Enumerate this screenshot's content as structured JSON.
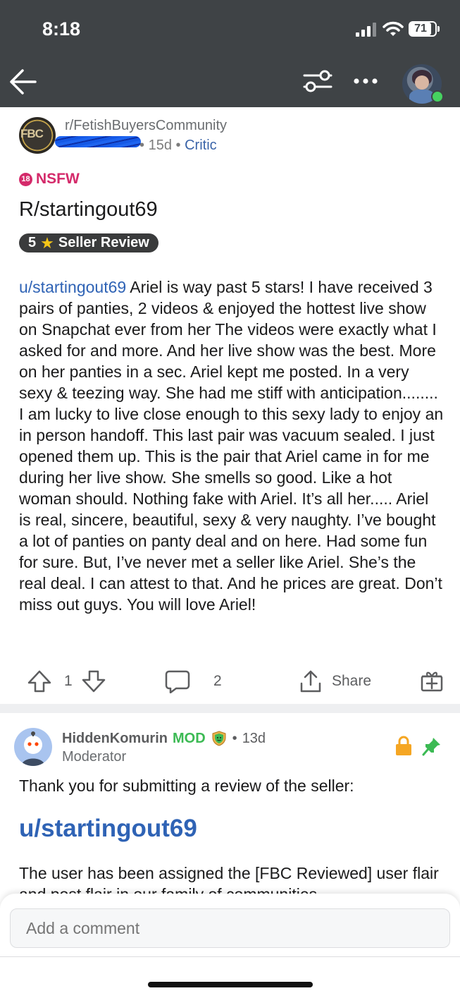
{
  "status_bar": {
    "time": "8:18",
    "battery": "71"
  },
  "nav": {
    "back_icon": "arrow-left-icon",
    "filter_icon": "sliders-icon",
    "more_icon": "ellipsis-icon",
    "avatar_icon": "user-avatar"
  },
  "post": {
    "subreddit_avatar_text": "FBC",
    "subreddit": "r/FetishBuyersCommunity",
    "age": "15d",
    "separator": "•",
    "author_flair": "Critic",
    "nsfw_badge": "18",
    "nsfw_label": "NSFW",
    "title": "R/startingout69",
    "flair_number": "5",
    "flair_label": "Seller Review",
    "body_user": "u/startingout69",
    "body_text": " Ariel is way past 5 stars!  I have received 3 pairs of panties, 2 videos & enjoyed the hottest live show on Snapchat ever from her The videos were exactly what I asked for and more. And her live show was the best. More on her panties in a sec. Ariel kept me posted. In a very sexy & teezing way. She had me stiff with anticipation........ I am lucky to live close enough to this sexy lady to enjoy an in person handoff. This last pair was vacuum sealed. I just opened them up. This is the pair that Ariel came in for me during her live show. She smells so good. Like a hot woman should. Nothing fake with Ariel. It’s all her..... Ariel is real, sincere, beautiful, sexy & very naughty. I’ve bought a lot of panties on panty deal and on here. Had some fun for sure. But, I’ve never met a seller like Ariel. She’s the real deal. I can attest to that. And he prices are great. Don’t miss out guys. You will love Ariel!",
    "votes": "1",
    "comments": "2",
    "share_label": "Share"
  },
  "comment": {
    "author": "HiddenKomurin",
    "mod_label": "MOD",
    "age": "13d",
    "separator": "•",
    "role": "Moderator",
    "text": "Thank you for submitting a review of the seller:",
    "link": "u/startingout69",
    "text2": "The user has been assigned the [FBC Reviewed] user flair and post flair in our family of communities"
  },
  "composer": {
    "placeholder": "Add a comment"
  },
  "colors": {
    "header_bg": "#3f4346",
    "link_blue": "#2f63b5",
    "nsfw_pink": "#d42a6a",
    "mod_green": "#3cba54",
    "lock_orange": "#f5a623"
  }
}
